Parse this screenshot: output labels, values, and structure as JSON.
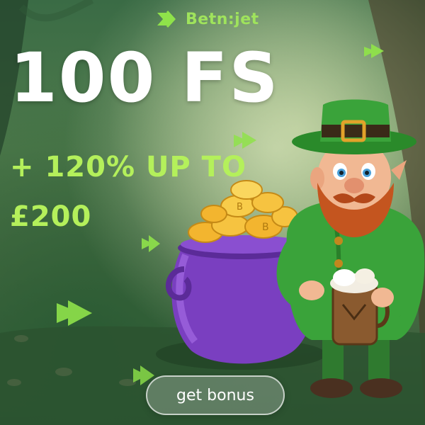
{
  "brand": {
    "logo_text": "Betn:jet",
    "accent_color": "#9fe35c"
  },
  "promo": {
    "headline": "100 FS",
    "offer_line1": "+ 120% UP TO",
    "offer_line2": "£200"
  },
  "cta": {
    "label": "get bonus"
  },
  "colors": {
    "headline": "#ffffff",
    "offer": "#b4f05b",
    "pot": "#7a3fc0",
    "leprechaun_coat": "#3aa33a"
  },
  "icons": [
    "chevron-right-icon",
    "coin-icon",
    "pot-of-gold",
    "leprechaun",
    "beer-mug"
  ]
}
